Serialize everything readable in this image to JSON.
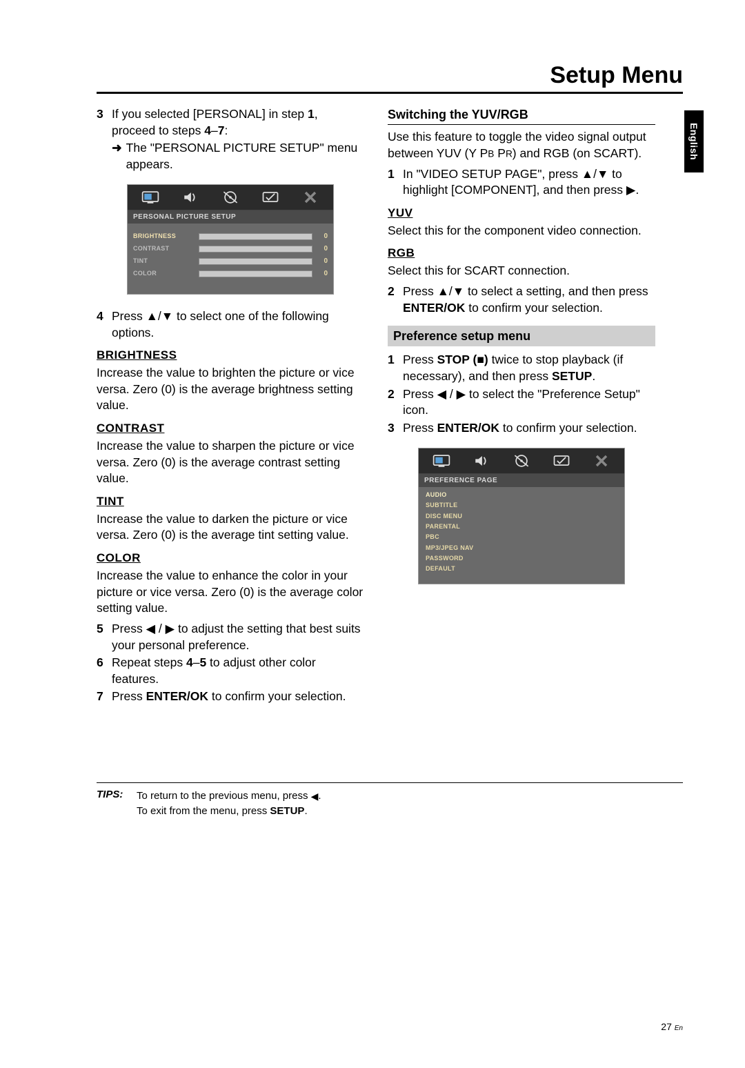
{
  "page_title": "Setup Menu",
  "language_tab": "English",
  "footer": {
    "num": "27",
    "lang": "En"
  },
  "tips": {
    "label": "TIPS:",
    "line1_a": "To return to the previous menu, press ",
    "line1_b": ".",
    "line2_a": "To exit from the menu, press ",
    "line2_b": "SETUP",
    "line2_c": "."
  },
  "left": {
    "step3_a": "If you selected [PERSONAL] in step ",
    "step3_b": "1",
    "step3_c": ", proceed to steps ",
    "step3_d": "4",
    "step3_e": "–",
    "step3_f": "7",
    "step3_g": ":",
    "step3_sub_a": "The \"PERSONAL PICTURE SETUP\" menu appears.",
    "step4": "Press ▲/▼ to select one of the following options.",
    "brightness_h": "BRIGHTNESS",
    "brightness_t": "Increase the value to brighten the picture or vice versa. Zero (0) is the average brightness setting value.",
    "contrast_h": "CONTRAST",
    "contrast_t": "Increase the value to sharpen the picture or vice versa. Zero (0) is the average contrast setting value.",
    "tint_h": "TINT",
    "tint_t": "Increase the value to darken the picture or vice versa. Zero (0) is the average tint setting value.",
    "color_h": "COLOR",
    "color_t": "Increase the value to enhance the color in your picture or vice versa. Zero (0) is the average color setting value.",
    "step5": "Press ◀ / ▶ to adjust the setting that best suits your personal preference.",
    "step6_a": "Repeat steps ",
    "step6_b": "4",
    "step6_c": "–",
    "step6_d": "5",
    "step6_e": " to adjust other color features.",
    "step7_a": "Press ",
    "step7_b": "ENTER/OK",
    "step7_c": " to confirm your selection."
  },
  "osd1": {
    "label": "PERSONAL PICTURE SETUP",
    "rows": [
      {
        "name": "BRIGHTNESS",
        "val": "0",
        "hi": true
      },
      {
        "name": "CONTRAST",
        "val": "0",
        "hi": false
      },
      {
        "name": "TINT",
        "val": "0",
        "hi": false
      },
      {
        "name": "COLOR",
        "val": "0",
        "hi": false
      }
    ]
  },
  "right": {
    "yuv_rgb_h": "Switching the YUV/RGB",
    "yuv_rgb_t_a": "Use this feature to toggle the video signal output between YUV (Y P",
    "yuv_rgb_t_b": "B",
    "yuv_rgb_t_c": " P",
    "yuv_rgb_t_d": "R",
    "yuv_rgb_t_e": ") and RGB (on SCART).",
    "r_step1_a": "In \"VIDEO SETUP PAGE\", press ▲/▼ to highlight [COMPONENT], and then press ▶.",
    "yuv_h": "YUV",
    "yuv_t": "Select this for the component video connection.",
    "rgb_h": "RGB",
    "rgb_t": "Select this for SCART connection.",
    "r_step2_a": "Press ▲/▼ to select a setting, and then press ",
    "r_step2_b": "ENTER/OK",
    "r_step2_c": " to confirm your selection.",
    "pref_h": "Preference setup menu",
    "p_step1_a": "Press ",
    "p_step1_b": "STOP (■)",
    "p_step1_c": " twice to stop playback (if necessary), and then press ",
    "p_step1_d": "SETUP",
    "p_step1_e": ".",
    "p_step2": "Press ◀ / ▶ to select the \"Preference Setup\" icon.",
    "p_step3_a": "Press ",
    "p_step3_b": "ENTER/OK",
    "p_step3_c": " to confirm your selection."
  },
  "osd2": {
    "label": "PREFERENCE PAGE",
    "items": [
      "AUDIO",
      "SUBTITLE",
      "DISC MENU",
      "PARENTAL",
      "PBC",
      "MP3/JPEG NAV",
      "PASSWORD",
      "DEFAULT"
    ]
  }
}
